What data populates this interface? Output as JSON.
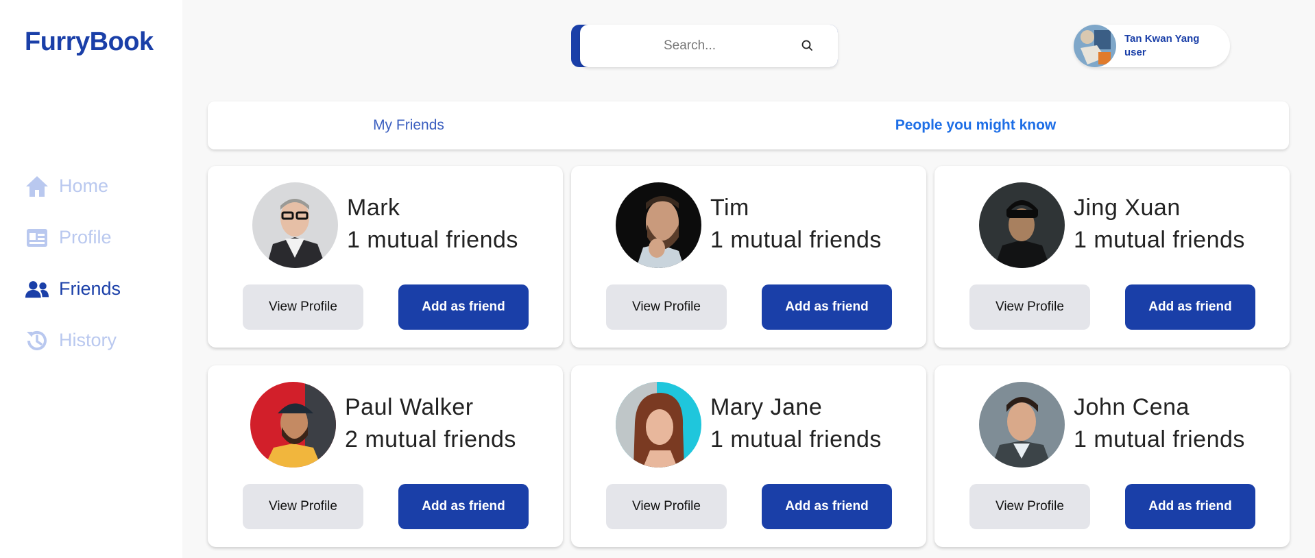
{
  "app": {
    "logo": "FurryBook"
  },
  "sidebar": {
    "items": [
      {
        "label": "Home",
        "icon": "home-icon",
        "active": false
      },
      {
        "label": "Profile",
        "icon": "id-card-icon",
        "active": false
      },
      {
        "label": "Friends",
        "icon": "users-icon",
        "active": true
      },
      {
        "label": "History",
        "icon": "history-icon",
        "active": false
      }
    ]
  },
  "search": {
    "placeholder": "Search..."
  },
  "user": {
    "name": "Tan Kwan Yang",
    "role": "user"
  },
  "tabs": [
    {
      "label": "My Friends",
      "active": false
    },
    {
      "label": "People you might know",
      "active": true
    }
  ],
  "people": [
    {
      "name": "Mark",
      "mutual": "1 mutual friends",
      "view_label": "View Profile",
      "add_label": "Add as friend"
    },
    {
      "name": "Tim",
      "mutual": "1 mutual friends",
      "view_label": "View Profile",
      "add_label": "Add as friend"
    },
    {
      "name": "Jing Xuan",
      "mutual": "1 mutual friends",
      "view_label": "View Profile",
      "add_label": "Add as friend"
    },
    {
      "name": "Paul Walker",
      "mutual": "2 mutual friends",
      "view_label": "View Profile",
      "add_label": "Add as friend"
    },
    {
      "name": "Mary Jane",
      "mutual": "1 mutual friends",
      "view_label": "View Profile",
      "add_label": "Add as friend"
    },
    {
      "name": "John Cena",
      "mutual": "1 mutual friends",
      "view_label": "View Profile",
      "add_label": "Add as friend"
    }
  ],
  "colors": {
    "brand": "#1a3fa8",
    "nav_inactive": "#b9c8ef",
    "tab_active": "#1d6ee6",
    "button_secondary": "#e4e5ea"
  }
}
